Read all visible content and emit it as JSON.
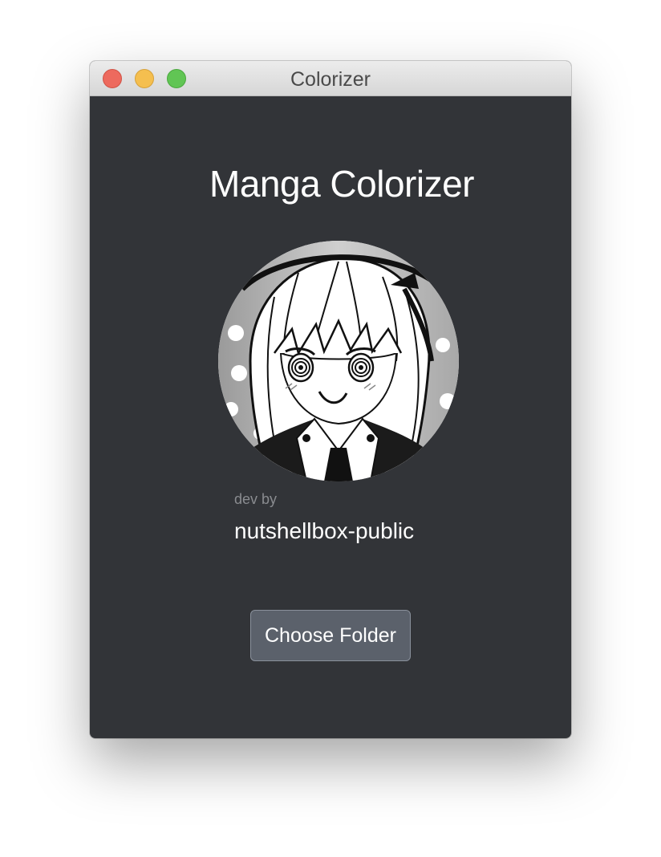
{
  "window": {
    "title": "Colorizer"
  },
  "main": {
    "title": "Manga Colorizer",
    "avatar_icon": "manga-girl-avatar",
    "dev_label": "dev by",
    "dev_name": "nutshellbox-public",
    "choose_button_label": "Choose Folder"
  },
  "colors": {
    "window_bg": "#323438",
    "button_bg": "#5b616b",
    "close": "#ed6a5e",
    "minimize": "#f5bf4f",
    "maximize": "#61c554"
  }
}
